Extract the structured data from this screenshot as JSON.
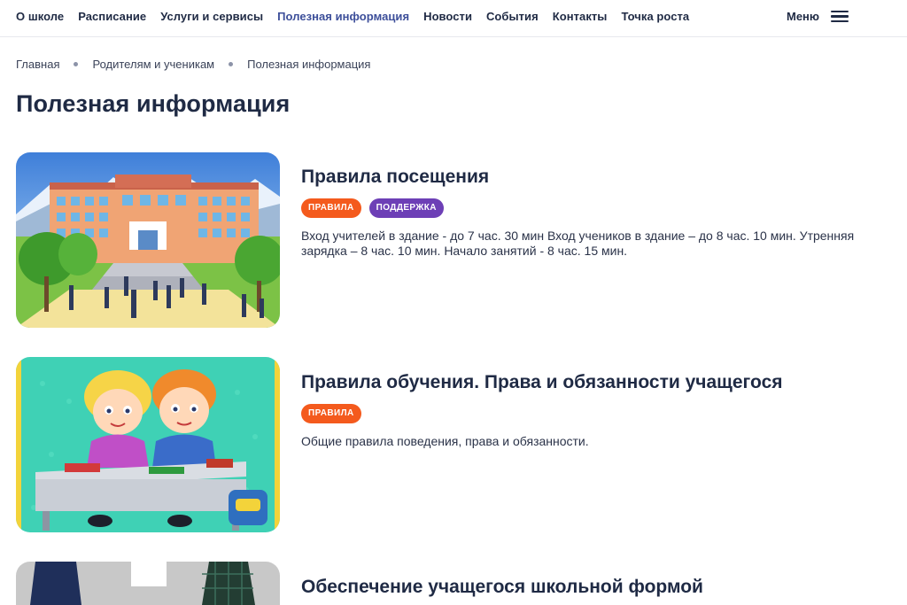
{
  "nav": {
    "items": [
      {
        "label": "О школе"
      },
      {
        "label": "Расписание"
      },
      {
        "label": "Услуги и сервисы"
      },
      {
        "label": "Полезная информация"
      },
      {
        "label": "Новости"
      },
      {
        "label": "События"
      },
      {
        "label": "Контакты"
      },
      {
        "label": "Точка роста"
      }
    ],
    "active_index": 3,
    "menu_label": "Меню"
  },
  "breadcrumb": [
    "Главная",
    "Родителям и ученикам",
    "Полезная информация"
  ],
  "page_title": "Полезная информация",
  "cards": [
    {
      "title": "Правила посещения",
      "tags": [
        {
          "label": "ПРАВИЛА",
          "color": "#f45a1d"
        },
        {
          "label": "ПОДДЕРЖКА",
          "color": "#6d3fb6"
        }
      ],
      "description": "Вход учителей в здание - до 7 час. 30 мин Вход учеников в здание – до 8 час. 10 мин. Утренняя зарядка – 8 час. 10 мин. Начало занятий - 8 час. 15 мин.",
      "image": "school-building-illustration"
    },
    {
      "title": "Правила обучения. Права и обязанности учащегося",
      "tags": [
        {
          "label": "ПРАВИЛА",
          "color": "#f45a1d"
        }
      ],
      "description": "Общие правила поведения, права и обязанности.",
      "image": "kids-at-desk-illustration"
    },
    {
      "title": "Обеспечение учащегося школьной формой",
      "tags": [],
      "description": "",
      "image": "school-uniform-photo"
    }
  ],
  "colors": {
    "text": "#1f2a44",
    "active_nav": "#3d4f9a",
    "tag_orange": "#f45a1d",
    "tag_purple": "#6d3fb6"
  }
}
